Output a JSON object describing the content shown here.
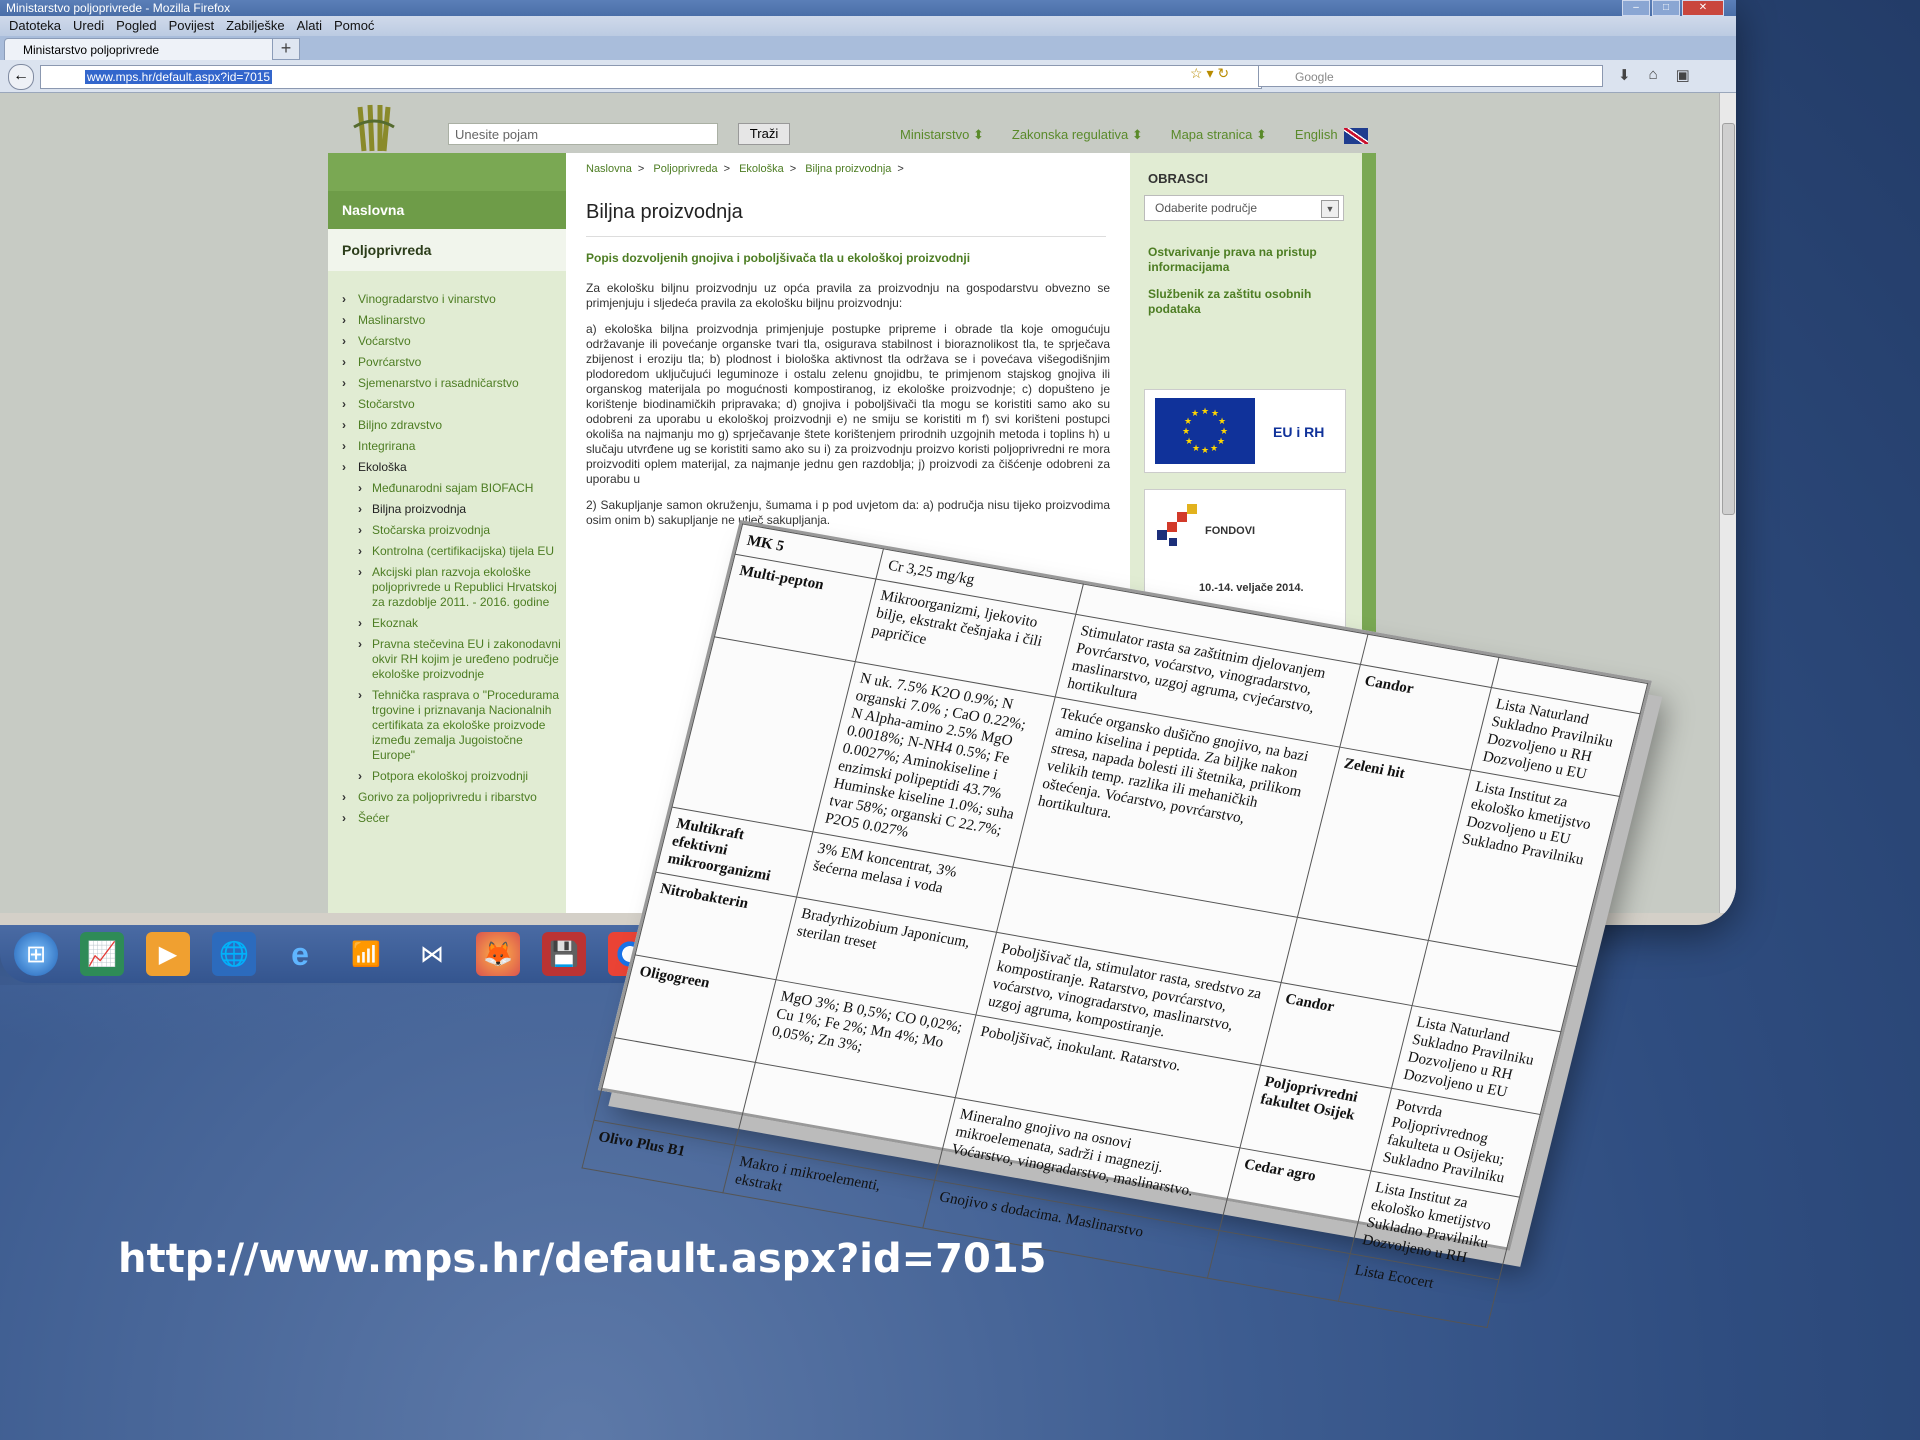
{
  "window": {
    "title": "Ministarstvo poljoprivrede - Mozilla Firefox"
  },
  "menubar": [
    "Datoteka",
    "Uredi",
    "Pogled",
    "Povijest",
    "Zabilješke",
    "Alati",
    "Pomoć"
  ],
  "tab": {
    "label": "Ministarstvo poljoprivrede",
    "new_tab": "+"
  },
  "address": {
    "url": "www.mps.hr/default.aspx?id=7015",
    "search_placeholder": "Google"
  },
  "site": {
    "search_placeholder": "Unesite pojam",
    "search_button": "Traži",
    "top_nav": [
      "Ministarstvo",
      "Zakonska regulativa",
      "Mapa stranica",
      "English"
    ],
    "left_nav": {
      "home": "Naslovna",
      "section": "Poljoprivreda",
      "items": [
        "Vinogradarstvo i vinarstvo",
        "Maslinarstvo",
        "Voćarstvo",
        "Povrćarstvo",
        "Sjemenarstvo i rasadničarstvo",
        "Stočarstvo",
        "Biljno zdravstvo",
        "Integrirana",
        "Ekološka"
      ],
      "sub_items": [
        "Međunarodni sajam BIOFACH",
        "Biljna proizvodnja",
        "Stočarska proizvodnja",
        "Kontrolna (certifikacijska) tijela EU",
        "Akcijski plan razvoja ekološke poljoprivrede u Republici Hrvatskoj za razdoblje 2011. - 2016. godine",
        "Ekoznak",
        "Pravna stečevina EU i zakonodavni okvir RH kojim je uređeno područje ekološke proizvodnje",
        "Tehnička rasprava o \"Procedurama trgovine i priznavanja Nacionalnih certifikata za ekološke proizvode između zemalja Jugoistočne Europe\"",
        "Potpora ekološkoj proizvodnji"
      ],
      "after_items": [
        "Gorivo za poljoprivredu i ribarstvo",
        "Šećer"
      ]
    },
    "breadcrumbs": [
      "Naslovna",
      "Poljoprivreda",
      "Ekološka",
      "Biljna proizvodnja"
    ],
    "page_title": "Biljna proizvodnja",
    "subtitle": "Popis dozvoljenih gnojiva i poboljšivača tla u ekološkoj proizvodnji",
    "paragraphs": [
      "Za ekološku biljnu proizvodnju uz opća pravila za proizvodnju na gospodarstvu obvezno se primjenjuju i sljedeća pravila za ekološku biljnu proizvodnju:",
      "a) ekološka biljna proizvodnja primjenjuje postupke pripreme i obrade tla koje omogućuju održavanje ili povećanje organske tvari tla, osigurava stabilnost i bioraznolikost tla, te sprječava zbijenost i eroziju tla; b) plodnost i biološka aktivnost tla održava se i povećava višegodišnjim plodoredom uključujući leguminoze i ostalu zelenu gnojidbu, te primjenom stajskog gnojiva ili organskog materijala po mogućnosti kompostiranog, iz ekološke proizvodnje; c) dopušteno je korištenje biodinamičkih pripravaka; d) gnojiva i poboljšivači tla mogu se koristiti samo ako su odobreni za uporabu u ekološkoj proizvodnji e) ne smiju se koristiti m f) svi korišteni postupci okoliša na najmanju mo g) sprječavanje štete korištenjem prirodnih uzgojnih metoda i toplins h) u slučaju utvrđene ug se koristiti samo ako su i) za proizvodnju proizvo koristi poljoprivredni re mora proizvoditi oplem materijal, za najmanje jednu gen razdoblja; j) proizvodi za čišćenje odobreni za uporabu u",
      "2) Sakupljanje samon okruženju, šumama i p pod uvjetom da: a) područja nisu tijeko proizvodima osim onim b) sakupljanje ne utječ sakupljanja."
    ],
    "right": {
      "heading": "OBRASCI",
      "select": "Odaberite područje",
      "link1": "Ostvarivanje prava na pristup informacijama",
      "link2": "Službenik za zaštitu osobnih podataka",
      "eu_label": "EU i RH",
      "fondovi_label": "FONDOVI",
      "fondovi_date": "10.-14. veljače 2014."
    }
  },
  "taskbar": [
    "start",
    "chart",
    "media",
    "globe",
    "ie",
    "wifi",
    "bow",
    "firefox",
    "save",
    "chrome",
    "folder"
  ],
  "table": {
    "rows": [
      {
        "name": "MK 5",
        "composition": "Cr 3,25 mg/kg",
        "use": "",
        "manufacturer": "",
        "registration": ""
      },
      {
        "name": "Multi-pepton",
        "composition": "Mikroorganizmi, ljekovito bilje, ekstrakt češnjaka i čili papričice",
        "use": "Stimulator rasta sa zaštitnim djelovanjem Povrćarstvo, voćarstvo, vinogradarstvo, maslinarstvo, uzgoj agruma, cvjećarstvo, hortikultura",
        "manufacturer": "Candor",
        "registration": "Lista Naturland Sukladno Pravilniku Dozvoljeno u RH Dozvoljeno u EU"
      },
      {
        "name": "",
        "composition": "N uk. 7.5% K2O 0.9%; N organski 7.0% ; CaO 0.22%; N Alpha-amino 2.5% MgO 0.0018%; N-NH4 0.5%; Fe 0.0027%; Aminokiseline i enzimski polipeptidi 43.7% Huminske kiseline 1.0%; suha tvar 58%; organski C 22.7%; P2O5 0.027%",
        "use": "Tekuće organsko dušično gnojivo, na bazi amino kiselina i peptida. Za biljke nakon stresa, napada bolesti ili štetnika, prilikom velikih temp. razlika ili mehaničkih oštećenja. Voćarstvo, povrćarstvo, hortikultura.",
        "manufacturer": "Zeleni hit",
        "registration": "Lista Institut za ekološko kmetijstvo Dozvoljeno u EU Sukladno Pravilniku"
      },
      {
        "name": "Multikraft efektivni mikroorganizmi",
        "composition": "3% EM koncentrat, 3% šećerna melasa i voda",
        "use": "",
        "manufacturer": "",
        "registration": ""
      },
      {
        "name": "Nitrobakterin",
        "composition": "Bradyrhizobium Japonicum, sterilan treset",
        "use": "Poboljšivač tla, stimulator rasta, sredstvo za kompostiranje. Ratarstvo, povrćarstvo, voćarstvo, vinogradarstvo, maslinarstvo, uzgoj agruma, kompostiranje.",
        "manufacturer": "Candor",
        "registration": "Lista Naturland Sukladno Pravilniku Dozvoljeno u RH Dozvoljeno u EU"
      },
      {
        "name": "Oligogreen",
        "composition": "MgO 3%; B 0,5%; CO 0,02%; Cu 1%; Fe 2%; Mn 4%; Mo 0,05%; Zn 3%;",
        "use": "Poboljšivač, inokulant. Ratarstvo.",
        "manufacturer": "Poljoprivredni fakultet Osijek",
        "registration": "Potvrda Poljoprivrednog fakulteta u Osijeku; Sukladno Pravilniku"
      },
      {
        "name": "",
        "composition": "",
        "use": "Mineralno gnojivo na osnovi mikroelemenata, sadrži i magnezij. Voćarstvo, vinogradarstvo, maslinarstvo.",
        "manufacturer": "Cedar agro",
        "registration": "Lista Institut za ekološko kmetijstvo Sukladno Pravilniku Dozvoljeno u RH"
      },
      {
        "name": "Olivo Plus B1",
        "composition": "Makro i mikroelementi, ekstrakt",
        "use": "Gnojivo s dodacima. Maslinarstvo",
        "manufacturer": "",
        "registration": "Lista Ecocert"
      }
    ]
  },
  "footer_url": "http://www.mps.hr/default.aspx?id=7015"
}
